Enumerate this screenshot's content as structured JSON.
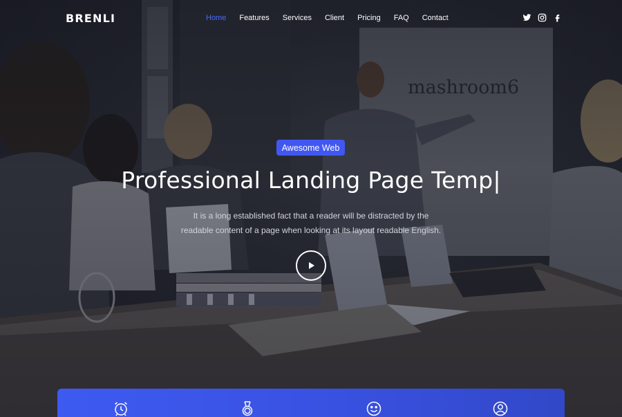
{
  "brand": {
    "logo": "BRENLI"
  },
  "nav": {
    "items": [
      {
        "label": "Home",
        "active": true
      },
      {
        "label": "Features",
        "active": false
      },
      {
        "label": "Services",
        "active": false
      },
      {
        "label": "Client",
        "active": false
      },
      {
        "label": "Pricing",
        "active": false
      },
      {
        "label": "FAQ",
        "active": false
      },
      {
        "label": "Contact",
        "active": false
      }
    ]
  },
  "social": {
    "icons": [
      "twitter-icon",
      "instagram-icon",
      "facebook-icon"
    ]
  },
  "hero": {
    "badge": "Awesome Web",
    "headline": "Professional Landing Page Temp|",
    "description_line1": "It is a long established fact that a reader will be distracted by the",
    "description_line2": "readable content of a page when looking at its layout readable English.",
    "wall_sign": "mashroom6"
  },
  "features": {
    "icons": [
      "alarm-clock-icon",
      "medal-icon",
      "smiley-icon",
      "user-icon"
    ]
  },
  "colors": {
    "accent": "#4157f2",
    "nav_active": "#4a6cf7",
    "feature_bar": "#3d5af1"
  }
}
